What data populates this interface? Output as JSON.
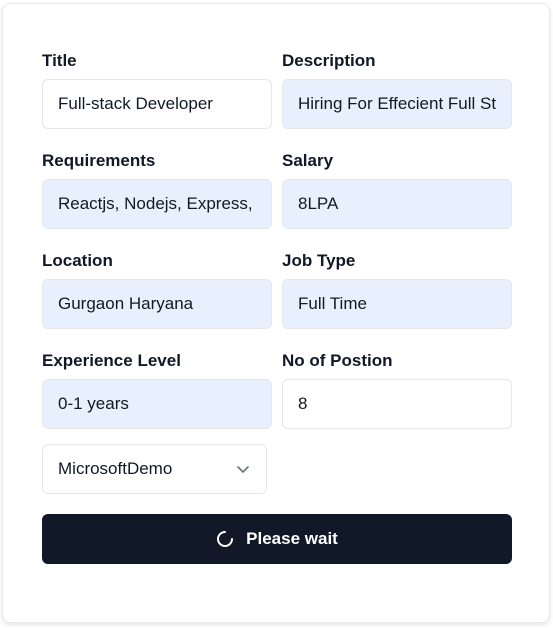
{
  "form": {
    "title": {
      "label": "Title",
      "value": "Full-stack Developer"
    },
    "description": {
      "label": "Description",
      "value": "Hiring For Effecient Full Stack Developer"
    },
    "requirements": {
      "label": "Requirements",
      "value": "Reactjs, Nodejs, Express, MongoDB"
    },
    "salary": {
      "label": "Salary",
      "value": "8LPA"
    },
    "location": {
      "label": "Location",
      "value": "Gurgaon Haryana"
    },
    "job_type": {
      "label": "Job Type",
      "value": "Full Time"
    },
    "experience": {
      "label": "Experience Level",
      "value": "0-1 years"
    },
    "positions": {
      "label": "No of Postion",
      "value": "8"
    },
    "company_select": {
      "selected": "MicrosoftDemo",
      "icon": "chevron-down-icon"
    },
    "submit": {
      "label": "Please wait",
      "icon": "loader-spinner-icon"
    }
  },
  "colors": {
    "autofill_bg": "#e8f0fe",
    "button_bg": "#111827",
    "border": "#e5e7eb"
  }
}
